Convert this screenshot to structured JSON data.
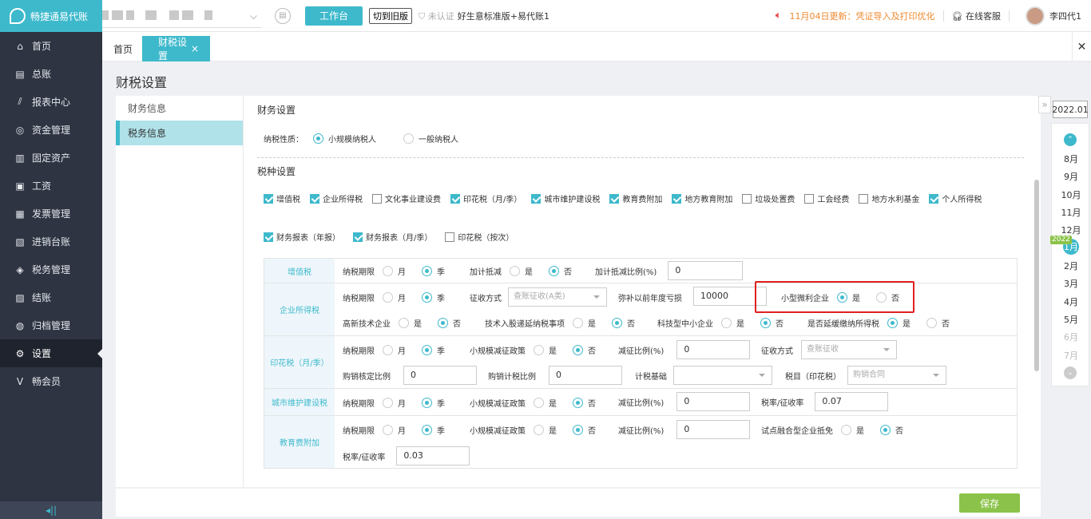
{
  "app": {
    "logo_text": "畅捷通易代账"
  },
  "colors": {
    "accent": "#3eb9cc",
    "sidebar": "#2e3442",
    "save": "#8bc34a",
    "notice": "#ee8a30",
    "highlight": "#e02020"
  },
  "sidebar": {
    "items": [
      {
        "label": "首页",
        "icon": "home-icon"
      },
      {
        "label": "总账",
        "icon": "ledger-icon"
      },
      {
        "label": "报表中心",
        "icon": "chart-icon"
      },
      {
        "label": "资金管理",
        "icon": "money-icon"
      },
      {
        "label": "固定资产",
        "icon": "asset-icon"
      },
      {
        "label": "工资",
        "icon": "salary-icon"
      },
      {
        "label": "发票管理",
        "icon": "invoice-icon"
      },
      {
        "label": "进销台账",
        "icon": "inventory-icon"
      },
      {
        "label": "税务管理",
        "icon": "tax-icon"
      },
      {
        "label": "结账",
        "icon": "close-account-icon"
      },
      {
        "label": "归档管理",
        "icon": "archive-icon"
      },
      {
        "label": "设置",
        "icon": "gear-icon"
      },
      {
        "label": "畅会员",
        "icon": "vip-icon"
      }
    ]
  },
  "header": {
    "work_btn": "工作台",
    "old_btn": "切到旧版",
    "unverified": "未认证",
    "edition": "好生意标准版+易代账1",
    "notice": "11月04日更新：凭证导入及打印优化",
    "service": "在线客服",
    "username": "李四代1"
  },
  "tabs": {
    "home": "首页",
    "fiscal": "财税设置",
    "close": "×"
  },
  "page": {
    "title": "财税设置"
  },
  "leftnav": {
    "finance": "财务信息",
    "tax": "税务信息"
  },
  "content": {
    "section_title": "财务设置",
    "nature_label": "纳税性质：",
    "nature_small": "小规模纳税人",
    "nature_general": "一般纳税人",
    "taxes_title": "税种设置",
    "checks1": [
      {
        "label": "增值税",
        "on": true
      },
      {
        "label": "企业所得税",
        "on": true
      },
      {
        "label": "文化事业建设费",
        "on": false
      },
      {
        "label": "印花税（月/季）",
        "on": true
      },
      {
        "label": "城市维护建设税",
        "on": true
      },
      {
        "label": "教育费附加",
        "on": true
      },
      {
        "label": "地方教育附加",
        "on": true
      },
      {
        "label": "垃圾处置费",
        "on": false
      },
      {
        "label": "工会经费",
        "on": false
      },
      {
        "label": "地方水利基金",
        "on": false
      },
      {
        "label": "个人所得税",
        "on": true
      }
    ],
    "checks2": [
      {
        "label": "财务报表（年报）",
        "on": true
      },
      {
        "label": "财务报表（月/季）",
        "on": true
      },
      {
        "label": "印花税（按次）",
        "on": false
      }
    ]
  },
  "labels": {
    "period": "纳税期限",
    "month": "月",
    "quarter": "季",
    "yes": "是",
    "no": "否",
    "add_deduct": "加计抵减",
    "add_ratio": "加计抵减比例(%)",
    "collect_method": "征收方式",
    "loss": "弥补以前年度亏损",
    "small_profit": "小型微利企业",
    "hightech": "高新技术企业",
    "tech_shares": "技术入股递延纳税事项",
    "tech_sme": "科技型中小企业",
    "defer_tax": "是否延缓缴纳所得税",
    "small_policy": "小规模减征政策",
    "reduce_ratio": "减征比例(%)",
    "purchase_ratio": "购销核定比例",
    "purchase_tax_ratio": "购销计税比例",
    "tax_basis": "计税基础",
    "tax_item": "税目（印花税）",
    "tax_rate": "税率/征收率",
    "pilot": "试点融合型企业抵免"
  },
  "vat": {
    "name": "增值税",
    "add_ratio_value": "0"
  },
  "cit": {
    "name": "企业所得税",
    "collect_value": "查账征收(A类)",
    "loss_value": "10000"
  },
  "stamp": {
    "name": "印花税（月/季）",
    "reduce_value": "0",
    "collect_value": "查账征收",
    "purchase_ratio_value": "0",
    "purchase_tax_value": "0",
    "tax_basis_value": "",
    "tax_item_value": "购销合同"
  },
  "urban": {
    "name": "城市维护建设税",
    "reduce_value": "0",
    "rate_value": "0.07"
  },
  "edu": {
    "name": "教育费附加",
    "reduce_value": "0",
    "rate_value": "0.03"
  },
  "months": {
    "year_box": "2022.01",
    "items": [
      "8月",
      "9月",
      "10月",
      "11月",
      "12月",
      "1月",
      "2月",
      "3月",
      "4月",
      "5月",
      "6月",
      "7月"
    ],
    "year_tag": "2022"
  },
  "footer": {
    "save": "保存"
  }
}
